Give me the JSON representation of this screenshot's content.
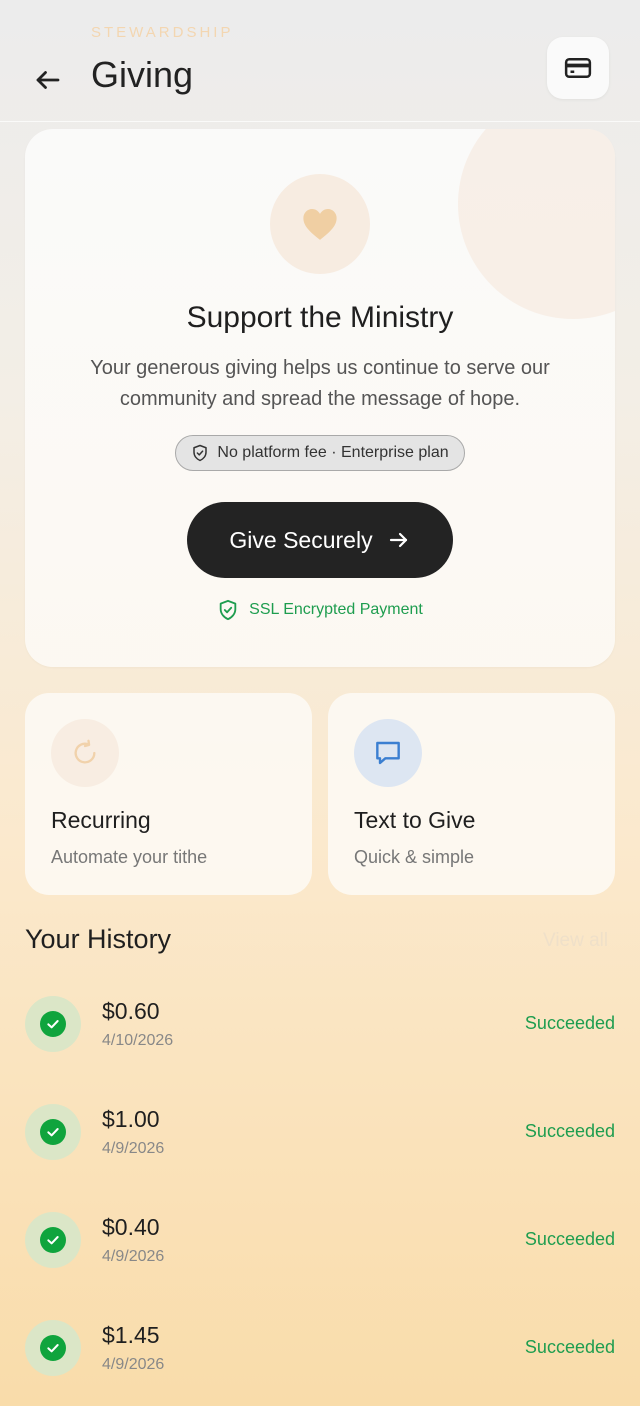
{
  "header": {
    "overline": "STEWARDSHIP",
    "title": "Giving",
    "back_icon": "arrow-left-icon",
    "card_icon": "credit-card-icon"
  },
  "hero": {
    "icon": "heart-icon",
    "title": "Support the Ministry",
    "description": "Your generous giving helps us continue to serve our community and spread the message of hope.",
    "fee_badge": "No platform fee · Enterprise plan",
    "give_button": "Give Securely",
    "ssl_text": "SSL Encrypted Payment"
  },
  "tiles": [
    {
      "title": "Recurring",
      "subtitle": "Automate your tithe",
      "icon": "refresh-icon"
    },
    {
      "title": "Text to Give",
      "subtitle": "Quick & simple",
      "icon": "chat-bubble-icon"
    }
  ],
  "history": {
    "title": "Your History",
    "view_all": "View all",
    "items": [
      {
        "amount": "$0.60",
        "date": "4/10/2026",
        "status": "Succeeded"
      },
      {
        "amount": "$1.00",
        "date": "4/9/2026",
        "status": "Succeeded"
      },
      {
        "amount": "$0.40",
        "date": "4/9/2026",
        "status": "Succeeded"
      },
      {
        "amount": "$1.45",
        "date": "4/9/2026",
        "status": "Succeeded"
      }
    ]
  },
  "colors": {
    "accent_green": "#1e9d4f",
    "button_dark": "#232323",
    "heart": "#f0cfa3",
    "chat_blue": "#3b7fd1"
  }
}
